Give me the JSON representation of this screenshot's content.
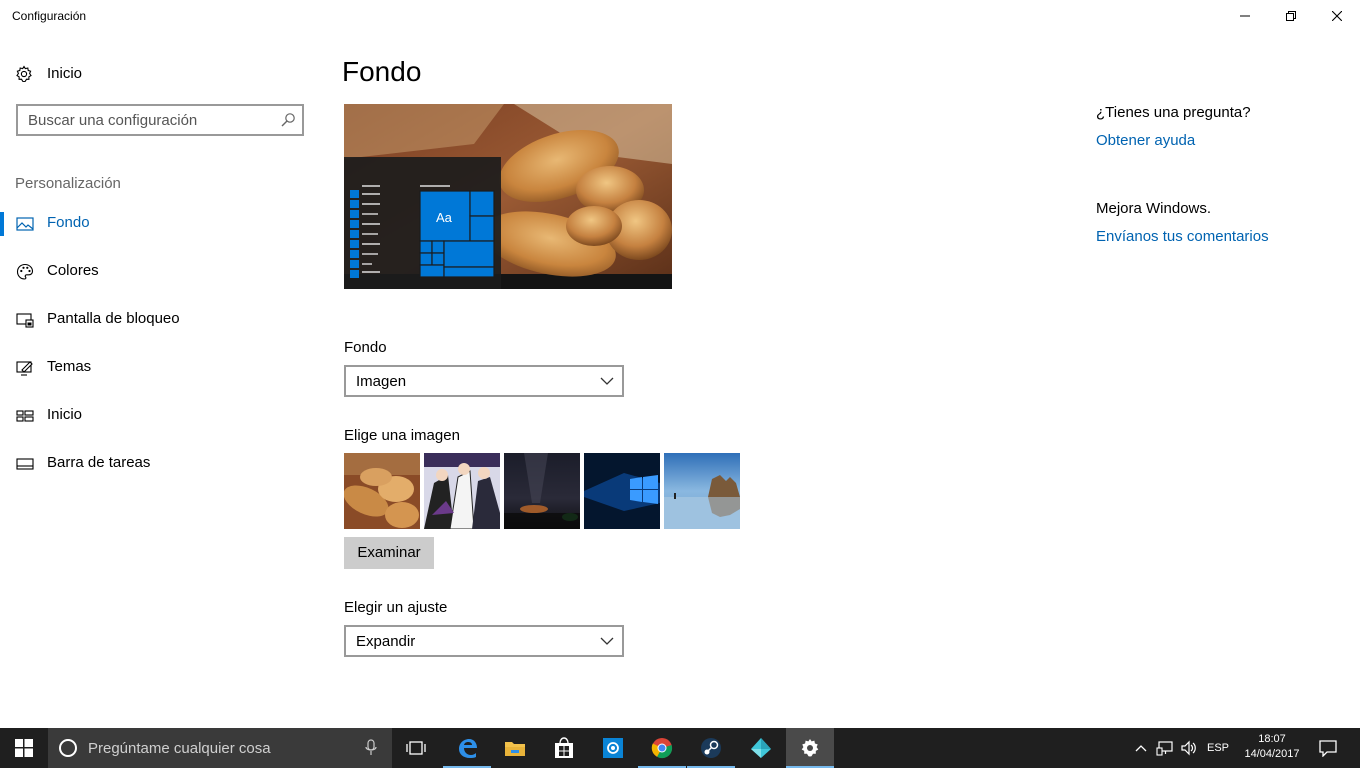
{
  "window": {
    "title": "Configuración",
    "minimize_icon": "minimize-icon",
    "restore_icon": "restore-icon",
    "close_icon": "close-icon"
  },
  "sidebar": {
    "home_label": "Inicio",
    "search_placeholder": "Buscar una configuración",
    "section_label": "Personalización",
    "items": [
      {
        "label": "Fondo",
        "icon": "picture-icon",
        "selected": true
      },
      {
        "label": "Colores",
        "icon": "palette-icon",
        "selected": false
      },
      {
        "label": "Pantalla de bloqueo",
        "icon": "lock-screen-icon",
        "selected": false
      },
      {
        "label": "Temas",
        "icon": "themes-icon",
        "selected": false
      },
      {
        "label": "Inicio",
        "icon": "start-tiles-icon",
        "selected": false
      },
      {
        "label": "Barra de tareas",
        "icon": "taskbar-icon",
        "selected": false
      }
    ]
  },
  "main": {
    "title": "Fondo",
    "preview_tile_text": "Aa",
    "background_label": "Fondo",
    "background_value": "Imagen",
    "choose_image_label": "Elige una imagen",
    "thumbnails": [
      "bread",
      "anime-characters",
      "night-sky",
      "windows-10-hero",
      "beach-rocks"
    ],
    "browse_button": "Examinar",
    "fit_label": "Elegir un ajuste",
    "fit_value": "Expandir"
  },
  "help": {
    "question": "¿Tienes una pregunta?",
    "get_help_link": "Obtener ayuda",
    "improve": "Mejora Windows.",
    "feedback_link": "Envíanos tus comentarios"
  },
  "taskbar": {
    "search_placeholder": "Pregúntame cualquier cosa",
    "apps": [
      "task-view-icon",
      "edge-icon",
      "file-explorer-icon",
      "store-icon",
      "outlook-icon",
      "chrome-icon",
      "steam-icon",
      "crystal-app-icon",
      "settings-icon"
    ],
    "language": "ESP",
    "time": "18:07",
    "date": "14/04/2017"
  },
  "colors": {
    "accent": "#0078d7",
    "link": "#0063b1",
    "taskbar": "#1f1f1f"
  }
}
